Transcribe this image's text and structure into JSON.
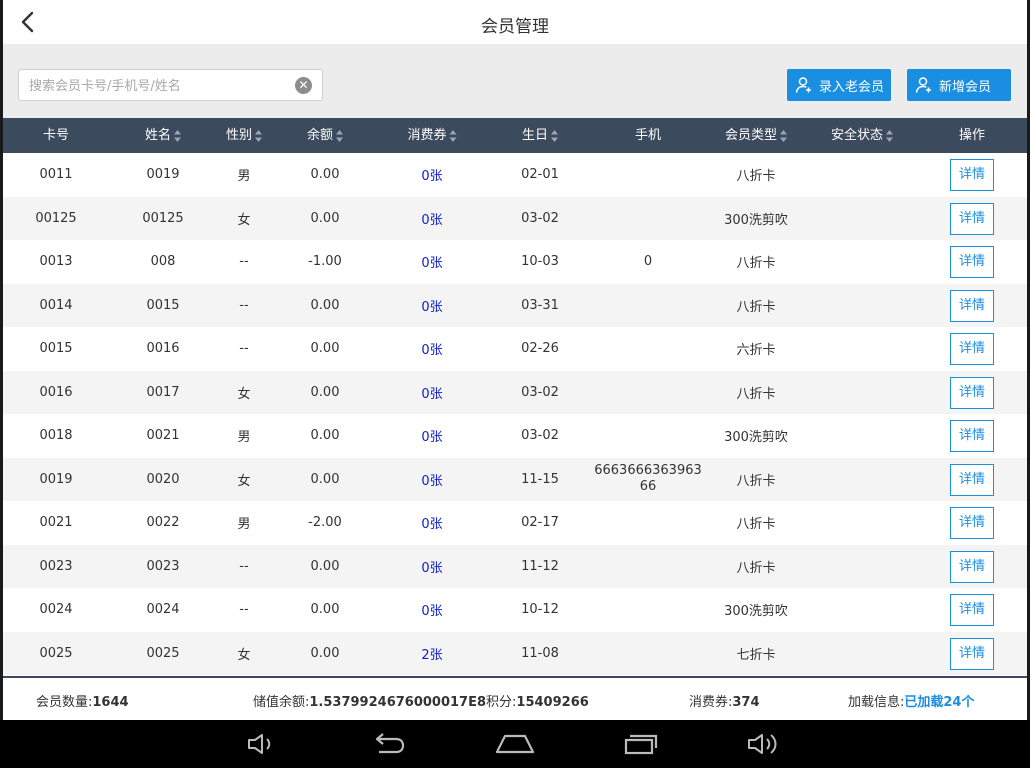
{
  "header": {
    "title": "会员管理"
  },
  "search": {
    "placeholder": "搜索会员卡号/手机号/姓名",
    "value": ""
  },
  "buttons": {
    "add_old": "录入老会员",
    "add_new": "新增会员"
  },
  "columns": [
    "卡号",
    "姓名",
    "性别",
    "余额",
    "消费券",
    "生日",
    "手机",
    "会员类型",
    "安全状态",
    "操作"
  ],
  "rows": [
    {
      "card": "0011",
      "name": "0019",
      "gender": "男",
      "balance": "0.00",
      "coupon": "0张",
      "birthday": "02-01",
      "phone": "",
      "type": "八折卡",
      "security": "",
      "action": "详情"
    },
    {
      "card": "00125",
      "name": "00125",
      "gender": "女",
      "balance": "0.00",
      "coupon": "0张",
      "birthday": "03-02",
      "phone": "",
      "type": "300洗剪吹",
      "security": "",
      "action": "详情"
    },
    {
      "card": "0013",
      "name": "008",
      "gender": "--",
      "balance": "-1.00",
      "coupon": "0张",
      "birthday": "10-03",
      "phone": "0",
      "type": "八折卡",
      "security": "",
      "action": "详情"
    },
    {
      "card": "0014",
      "name": "0015",
      "gender": "--",
      "balance": "0.00",
      "coupon": "0张",
      "birthday": "03-31",
      "phone": "",
      "type": "八折卡",
      "security": "",
      "action": "详情"
    },
    {
      "card": "0015",
      "name": "0016",
      "gender": "--",
      "balance": "0.00",
      "coupon": "0张",
      "birthday": "02-26",
      "phone": "",
      "type": "六折卡",
      "security": "",
      "action": "详情"
    },
    {
      "card": "0016",
      "name": "0017",
      "gender": "女",
      "balance": "0.00",
      "coupon": "0张",
      "birthday": "03-02",
      "phone": "",
      "type": "八折卡",
      "security": "",
      "action": "详情"
    },
    {
      "card": "0018",
      "name": "0021",
      "gender": "男",
      "balance": "0.00",
      "coupon": "0张",
      "birthday": "03-02",
      "phone": "",
      "type": "300洗剪吹",
      "security": "",
      "action": "详情"
    },
    {
      "card": "0019",
      "name": "0020",
      "gender": "女",
      "balance": "0.00",
      "coupon": "0张",
      "birthday": "11-15",
      "phone": "666366636396366",
      "type": "八折卡",
      "security": "",
      "action": "详情"
    },
    {
      "card": "0021",
      "name": "0022",
      "gender": "男",
      "balance": "-2.00",
      "coupon": "0张",
      "birthday": "02-17",
      "phone": "",
      "type": "八折卡",
      "security": "",
      "action": "详情"
    },
    {
      "card": "0023",
      "name": "0023",
      "gender": "--",
      "balance": "0.00",
      "coupon": "0张",
      "birthday": "11-12",
      "phone": "",
      "type": "八折卡",
      "security": "",
      "action": "详情"
    },
    {
      "card": "0024",
      "name": "0024",
      "gender": "--",
      "balance": "0.00",
      "coupon": "0张",
      "birthday": "10-12",
      "phone": "",
      "type": "300洗剪吹",
      "security": "",
      "action": "详情"
    },
    {
      "card": "0025",
      "name": "0025",
      "gender": "女",
      "balance": "0.00",
      "coupon": "2张",
      "birthday": "11-08",
      "phone": "",
      "type": "七折卡",
      "security": "",
      "action": "详情"
    }
  ],
  "footer": {
    "count_label": "会员数量:",
    "count_value": "1644",
    "balance_label": "储值余额:",
    "balance_value": "1.5379924676000017E8",
    "points_label": "积分:",
    "points_value": "15409266",
    "coupons_label": "消费券:",
    "coupons_value": "374",
    "load_label": "加载信息:",
    "load_value": "已加载24个"
  },
  "colors": {
    "accent": "#1a8ee0",
    "header_bg": "#3c4a5e",
    "coupon": "#1020c8"
  },
  "icons": [
    "back-icon",
    "clear-icon",
    "add-user-icon",
    "volume-down-icon",
    "nav-back-icon",
    "home-icon",
    "recents-icon",
    "volume-up-icon"
  ]
}
